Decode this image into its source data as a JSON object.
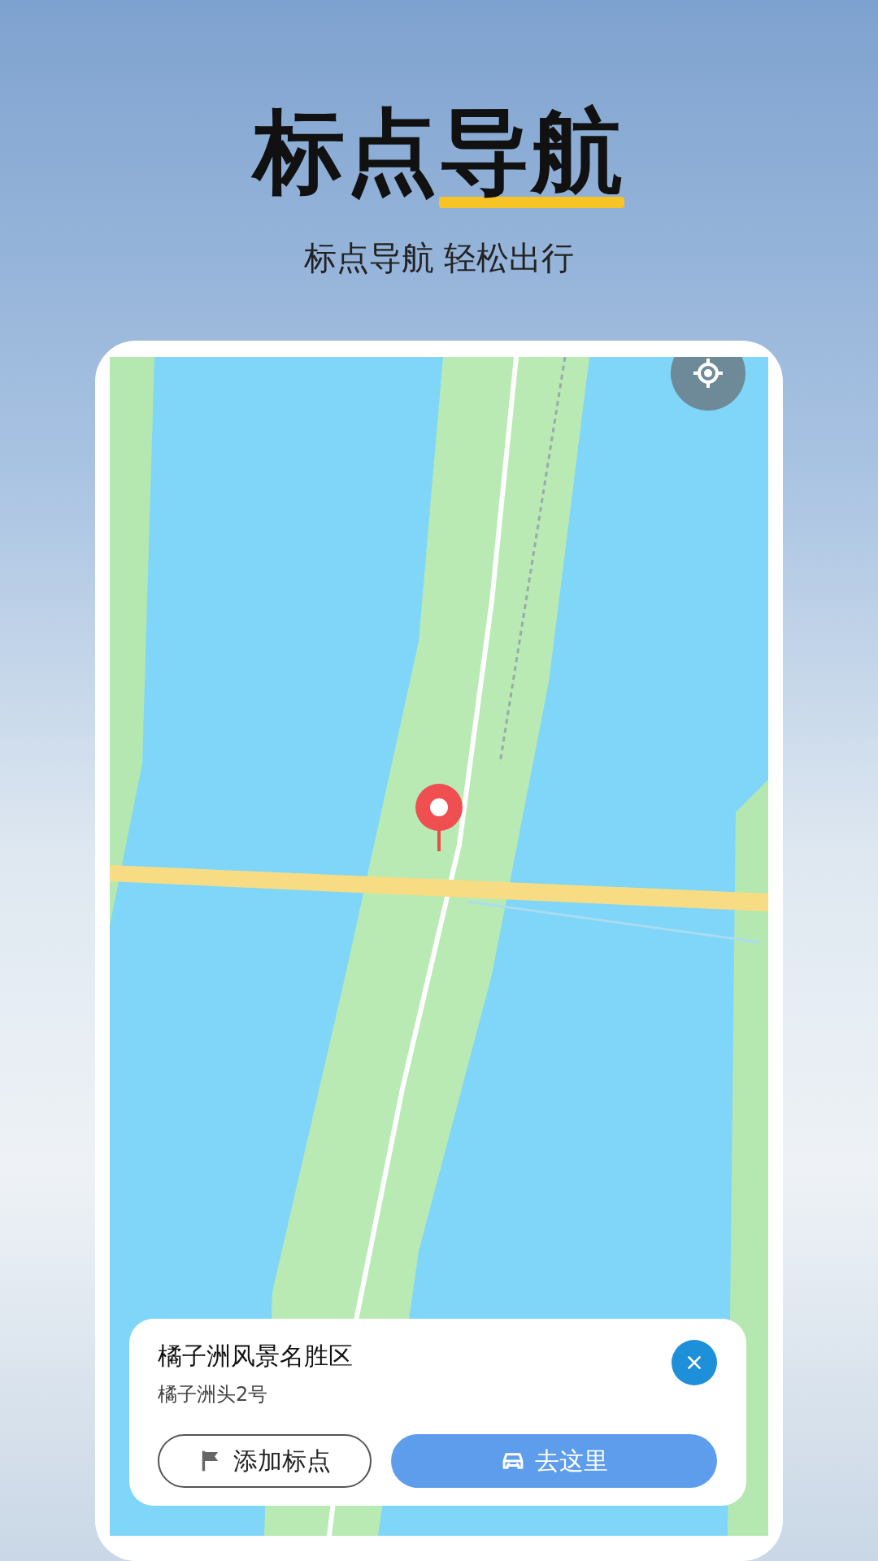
{
  "header": {
    "title": "标点导航",
    "subtitle": "标点导航 轻松出行"
  },
  "place_card": {
    "name": "橘子洲风景名胜区",
    "address": "橘子洲头2号",
    "buttons": [
      {
        "kind": "outline",
        "label": "添加标点"
      },
      {
        "kind": "primary",
        "label": "去这里"
      }
    ]
  }
}
